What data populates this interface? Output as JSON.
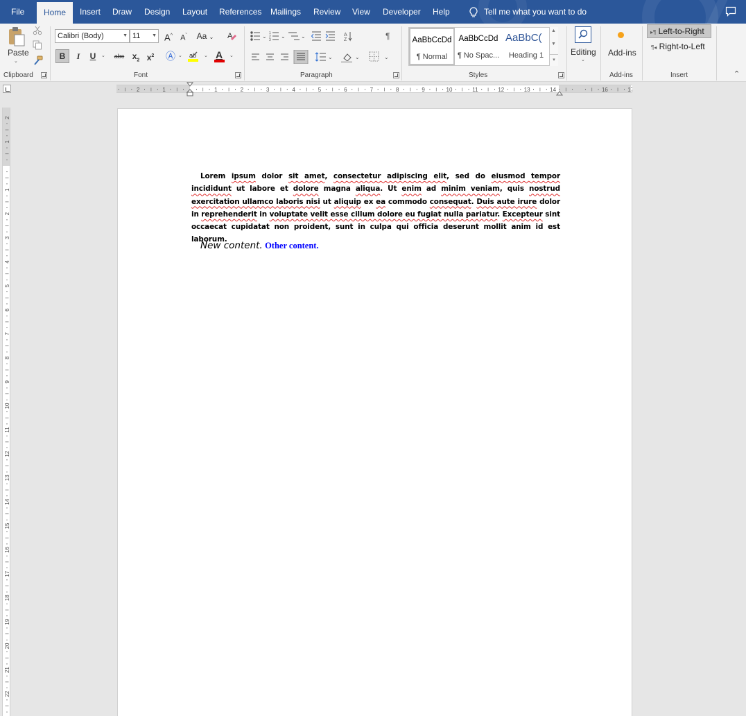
{
  "menu": {
    "tabs": [
      "File",
      "Home",
      "Insert",
      "Draw",
      "Design",
      "Layout",
      "References",
      "Mailings",
      "Review",
      "View",
      "Developer",
      "Help"
    ],
    "active_tab": "Home",
    "tell_me": "Tell me what you want to do"
  },
  "ribbon": {
    "clipboard": {
      "paste": "Paste",
      "label": "Clipboard"
    },
    "font": {
      "name": "Calibri (Body)",
      "size": "11",
      "change_case": "Aa",
      "strikethrough": "abc",
      "label": "Font"
    },
    "paragraph": {
      "label": "Paragraph"
    },
    "styles": {
      "items": [
        {
          "sample": "AaBbCcDd",
          "name": "¶ Normal"
        },
        {
          "sample": "AaBbCcDd",
          "name": "¶ No Spac..."
        },
        {
          "sample": "AaBbC(",
          "name": "Heading 1"
        }
      ],
      "label": "Styles"
    },
    "editing": {
      "label": "Editing"
    },
    "addins": {
      "button": "Add-ins",
      "label": "Add-ins"
    },
    "insert": {
      "ltr": "Left-to-Right",
      "rtl": "Right-to-Left",
      "label": "Insert"
    }
  },
  "rulers": {
    "horizontal": [
      "3",
      "2",
      "1",
      "1",
      "2",
      "3",
      "4",
      "5",
      "6",
      "7",
      "8",
      "9",
      "10",
      "11",
      "12",
      "13",
      "14",
      "16",
      "17"
    ],
    "vertical": [
      "2",
      "1",
      "1",
      "2",
      "3",
      "4",
      "5",
      "6",
      "7",
      "8",
      "9",
      "10",
      "11",
      "12",
      "13",
      "14",
      "15",
      "16",
      "17",
      "18",
      "19",
      "20",
      "21",
      "22"
    ]
  },
  "document": {
    "paragraph_segments": [
      {
        "text": "Lorem",
        "sq": false
      },
      {
        "text": " ",
        "sq": false
      },
      {
        "text": "ipsum",
        "sq": true
      },
      {
        "text": " dolor ",
        "sq": false
      },
      {
        "text": "sit amet",
        "sq": true
      },
      {
        "text": ", ",
        "sq": false
      },
      {
        "text": "consectetur adipiscing elit",
        "sq": true
      },
      {
        "text": ", sed do ",
        "sq": false
      },
      {
        "text": "eiusmod tempor incididunt",
        "sq": true
      },
      {
        "text": " ut labore et ",
        "sq": false
      },
      {
        "text": "dolore",
        "sq": true
      },
      {
        "text": " magna ",
        "sq": false
      },
      {
        "text": "aliqua",
        "sq": true
      },
      {
        "text": ". Ut ",
        "sq": false
      },
      {
        "text": "enim",
        "sq": true
      },
      {
        "text": " ad ",
        "sq": false
      },
      {
        "text": "minim veniam",
        "sq": true
      },
      {
        "text": ", quis ",
        "sq": false
      },
      {
        "text": "nostrud exercitation ullamco laboris nisi",
        "sq": true
      },
      {
        "text": " ut ",
        "sq": false
      },
      {
        "text": "aliquip",
        "sq": true
      },
      {
        "text": " ex ",
        "sq": false
      },
      {
        "text": "ea",
        "sq": true
      },
      {
        "text": " commodo ",
        "sq": false
      },
      {
        "text": "consequat",
        "sq": true
      },
      {
        "text": ". ",
        "sq": false
      },
      {
        "text": "Duis aute irure",
        "sq": true
      },
      {
        "text": " dolor in ",
        "sq": false
      },
      {
        "text": "reprehenderit",
        "sq": true
      },
      {
        "text": " in ",
        "sq": false
      },
      {
        "text": "voluptate velit esse cillum dolore eu fugiat nulla pariatur",
        "sq": true
      },
      {
        "text": ". ",
        "sq": false
      },
      {
        "text": "Excepteur",
        "sq": true
      },
      {
        "text": " sint occaecat cupidatat non proident, sunt in culpa qui officia deserunt mollit anim id est laborum.",
        "sq": false
      }
    ],
    "new_content": "New content.",
    "other_content": "Other content."
  },
  "colors": {
    "title_bar": "#2b579a",
    "other_content": "#0000ff",
    "spelling_underline": "#e03030"
  }
}
